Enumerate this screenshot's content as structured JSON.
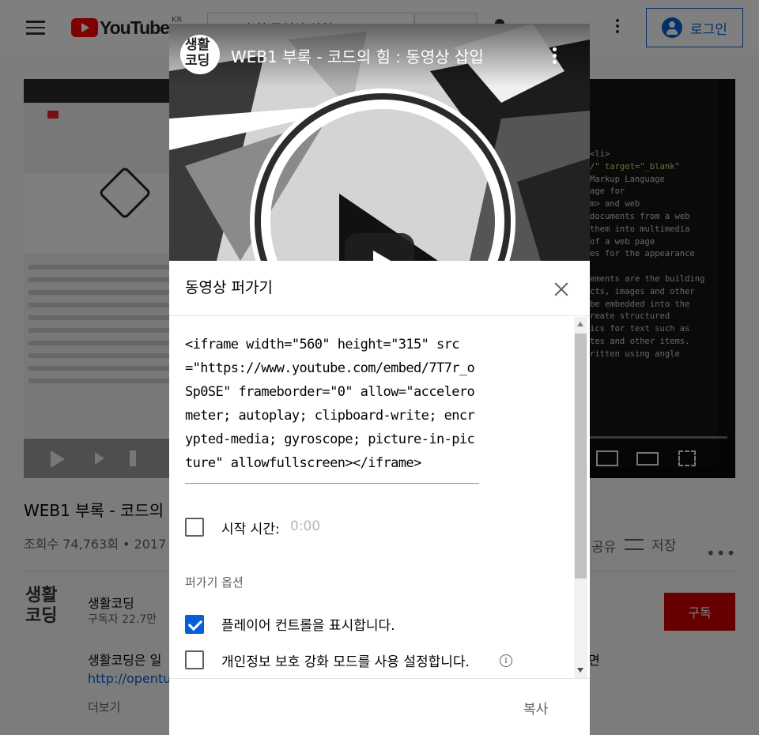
{
  "masthead": {
    "logo_text": "YouTube",
    "region": "KR",
    "search_value": "코드의 힘 동영상 삽입",
    "login_label": "로그인"
  },
  "player": {
    "code_lines": [
      "<li>",
      "/\" target=\"_blank\"",
      "Markup Language",
      "age for",
      "m> and web",
      "documents from a web",
      "them into multimedia",
      "of a web page",
      "es for the appearance",
      "",
      "ements are the building",
      "cts, images and other",
      "be embedded into the",
      "reate structured",
      "ics for text such as",
      "tes and other items.",
      "ritten using angle"
    ]
  },
  "video": {
    "title": "WEB1 부록 - 코드의",
    "meta": "조회수 74,763회 • 2017",
    "share_label": "공유",
    "save_label": "저장",
    "more_label": "•••"
  },
  "channel": {
    "logo_text": "생활코딩",
    "name": "생활코딩",
    "subscribers": "구독자 22.7만",
    "subscribe_label": "구독",
    "description_line": "생활코딩은 일",
    "description_link": "http://opentu",
    "description_end": "면",
    "more_label": "더보기"
  },
  "preview": {
    "avatar_text": "생활\n코딩",
    "title": "WEB1 부록 - 코드의 힘 : 동영상 삽입"
  },
  "dialog": {
    "title": "동영상 퍼가기",
    "embed_code": "<iframe width=\"560\" height=\"315\" src=\"https://www.youtube.com/embed/7T7r_oSp0SE\" frameborder=\"0\" allow=\"accelerometer; autoplay; clipboard-write; encrypted-media; gyroscope; picture-in-picture\" allowfullscreen></iframe>",
    "start_time_label": "시작 시간:",
    "start_time_value": "0:00",
    "start_time_checked": false,
    "options_heading": "퍼가기 옵션",
    "options": [
      {
        "label": "플레이어 컨트롤을 표시합니다.",
        "checked": true
      },
      {
        "label": "개인정보 보호 강화 모드를 사용 설정합니다.",
        "checked": false
      }
    ],
    "copy_label": "복사"
  },
  "colors": {
    "accent": "#065fd4",
    "brand_red": "#ff0000",
    "subscribe_red": "#cc0000",
    "scrim": "rgba(0,0,0,0.5)"
  },
  "icons": [
    "menu-icon",
    "search-icon",
    "mic-icon",
    "apps-icon",
    "more-vert-icon",
    "user-icon",
    "close-icon",
    "info-icon",
    "playlist-add-icon",
    "play-icon"
  ]
}
